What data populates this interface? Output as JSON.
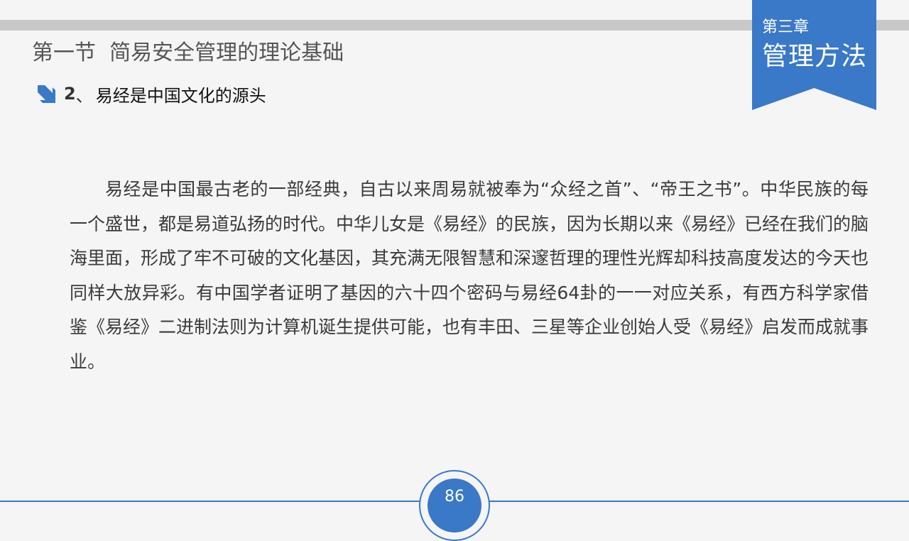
{
  "chapter": {
    "number_label": "第三章",
    "title": "管理方法"
  },
  "section": {
    "title": "第一节  简易安全管理的理论基础"
  },
  "subheading": {
    "icon": "arrow-down-right-icon",
    "number": "2",
    "separator": "、",
    "text": "易经是中国文化的源头"
  },
  "body": {
    "paragraph": "易经是中国最古老的一部经典，自古以来周易就被奉为“众经之首”、“帝王之书”。中华民族的每一个盛世，都是易道弘扬的时代。中华儿女是《易经》的民族，因为长期以来《易经》已经在我们的脑海里面，形成了牢不可破的文化基因，其充满无限智慧和深邃哲理的理性光辉却科技高度发达的今天也同样大放异彩。有中国学者证明了基因的六十四个密码与易经64卦的一一对应关系，有西方科学家借鉴《易经》二进制法则为计算机诞生提供可能，也有丰田、三星等企业创始人受《易经》启发而成就事业。"
  },
  "footer": {
    "page_number": "86"
  },
  "colors": {
    "accent": "#3a78c8",
    "top_bar": "#c8c8c8",
    "background": "#f5f5f5"
  }
}
